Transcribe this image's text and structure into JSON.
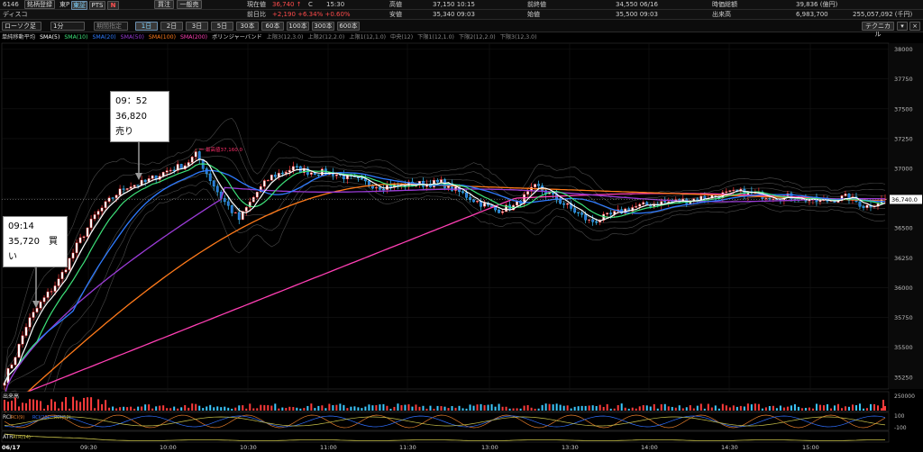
{
  "header": {
    "code": "6146",
    "watchlist_btn": "銘柄登録",
    "market_tag": "東P",
    "exchange_tse": "東証",
    "exchange_pts": "PTS",
    "n_badge": "N",
    "buy_btn": "買注",
    "sell_btn": "一般売",
    "name": "ディスコ",
    "current_label": "現在値",
    "current_value": "36,740 ↑",
    "current_flag": "C",
    "current_time": "15:30",
    "change_label": "前日比",
    "change_value": "+2,190 +6.34% +0.60%",
    "high_label": "高値",
    "high_value": "37,150 10:15",
    "open_label": "安値",
    "open_value": "35,340 09:03",
    "prev_label": "前終値",
    "prev_value": "34,550 06/16",
    "lo_label": "始値",
    "lo_value": "35,500 09:03",
    "mcap_label": "時価総額",
    "mcap_value": "39,836 (億円)",
    "vol_label": "出来高",
    "vol_value": "6,983,700",
    "turnover_value": "255,057,092 (千円)"
  },
  "toolbar": {
    "chart_type": "ローソク足",
    "interval": "1分",
    "period_placeholder": "期間指定",
    "ranges": [
      "1日",
      "2日",
      "3日",
      "5日",
      "30本",
      "60本",
      "100本",
      "300本",
      "600本"
    ],
    "selected_range": "1日",
    "technical_btn": "テクニカル"
  },
  "legend": {
    "title": "単純移動平均",
    "items": [
      {
        "label": "SMA(5)",
        "color": "#ffffff"
      },
      {
        "label": "SMA(10)",
        "color": "#3de27a"
      },
      {
        "label": "SMA(20)",
        "color": "#2f7bff"
      },
      {
        "label": "SMA(50)",
        "color": "#9a3bd6"
      },
      {
        "label": "SMA(100)",
        "color": "#ff7a1a"
      },
      {
        "label": "SMA(200)",
        "color": "#ff3fb4"
      }
    ],
    "bb_title": "ボリンジャーバンド",
    "bb_items": [
      "上限3(12,3.0)",
      "上限2(12,2.0)",
      "上限1(12,1.0)",
      "中央(12)",
      "下限1(12,1.0)",
      "下限2(12,2.0)",
      "下限3(12,3.0)"
    ]
  },
  "annotations": {
    "max_label": "最高値37,160.0",
    "price_tag": "36,740.0"
  },
  "callouts": {
    "sell_time": "09：52",
    "sell_price": "36,820　売り",
    "buy_time": "09:14",
    "buy_price": "35,720　買い"
  },
  "subcharts": {
    "volume_label": "出来高",
    "volume_axis": "250000",
    "rci_label": "RCI",
    "rci_items": [
      "RCI(9)",
      "RCI(26)",
      "RCI(52)"
    ],
    "rci_axis": [
      "100",
      "-100"
    ],
    "atr_label": "ATR",
    "atr_item": "ATR(14)",
    "date_label": "06/17"
  },
  "chart_data": {
    "type": "line",
    "y_ticks": [
      38000,
      37750,
      37500,
      37250,
      37000,
      36750,
      36500,
      36250,
      36000,
      35750,
      35500,
      35250
    ],
    "x_ticks": [
      "09:30",
      "10:00",
      "10:30",
      "11:00",
      "11:30",
      "13:00",
      "13:30",
      "14:00",
      "14:30",
      "15:00"
    ],
    "ylim": [
      35150,
      38050
    ],
    "close_price": 36740,
    "series": [
      {
        "name": "SMA(5)",
        "color": "#ffffff"
      },
      {
        "name": "SMA(10)",
        "color": "#3de27a"
      },
      {
        "name": "SMA(20)",
        "color": "#2f7bff"
      },
      {
        "name": "SMA(50)",
        "color": "#9a3bd6"
      },
      {
        "name": "SMA(100)",
        "color": "#ff7a1a"
      },
      {
        "name": "SMA(200)",
        "color": "#ff3fb4"
      }
    ]
  }
}
